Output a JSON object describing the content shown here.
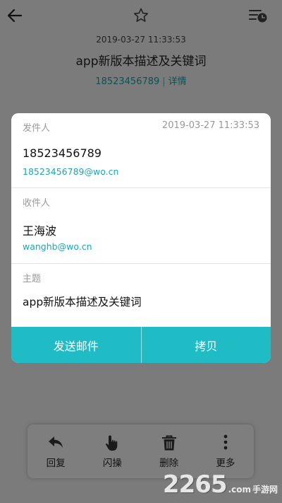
{
  "top_bar": {
    "back_icon": "back-arrow-icon",
    "star_icon": "star-icon",
    "filter_icon": "filter-clock-icon"
  },
  "mail_header": {
    "date": "2019-03-27 11:33:53",
    "subject": "app新版本描述及关键词",
    "sender_number": "18523456789",
    "separator": "|",
    "details_link": "详情"
  },
  "dialog": {
    "sender": {
      "label": "发件人",
      "date": "2019-03-27 11:33:53",
      "name": "18523456789",
      "email": "18523456789@wo.cn"
    },
    "receiver": {
      "label": "收件人",
      "name": "王海波",
      "email": "wanghb@wo.cn"
    },
    "subject": {
      "label": "主题",
      "text": "app新版本描述及关键词"
    },
    "actions": {
      "send_mail": "发送邮件",
      "copy": "拷贝"
    },
    "accent_color": "#1fbcc6"
  },
  "toolbar": {
    "items": [
      {
        "label": "回复",
        "icon": "reply-icon"
      },
      {
        "label": "闪操",
        "icon": "hand-pointer-icon"
      },
      {
        "label": "删除",
        "icon": "trash-icon"
      },
      {
        "label": "更多",
        "icon": "more-vertical-icon"
      }
    ]
  },
  "watermark": {
    "number": "2265",
    "suffix": ".com",
    "text": "手游网"
  }
}
